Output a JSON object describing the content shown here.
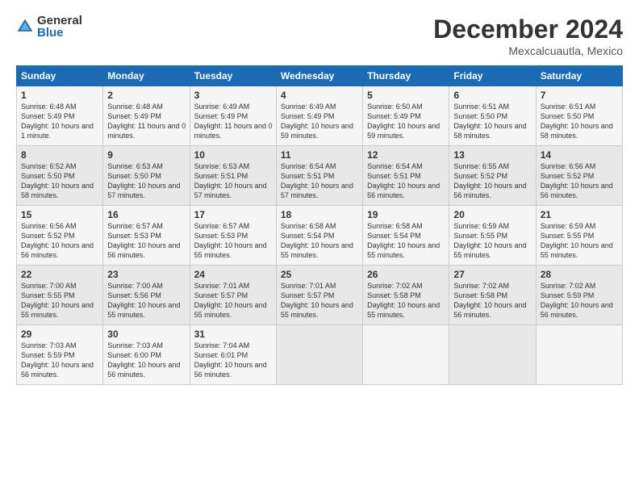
{
  "header": {
    "logo_general": "General",
    "logo_blue": "Blue",
    "title": "December 2024",
    "location": "Mexcalcuautla, Mexico"
  },
  "days_of_week": [
    "Sunday",
    "Monday",
    "Tuesday",
    "Wednesday",
    "Thursday",
    "Friday",
    "Saturday"
  ],
  "weeks": [
    [
      {
        "day": 1,
        "sunrise": "6:48 AM",
        "sunset": "5:49 PM",
        "daylight": "10 hours and 1 minute."
      },
      {
        "day": 2,
        "sunrise": "6:48 AM",
        "sunset": "5:49 PM",
        "daylight": "11 hours and 0 minutes."
      },
      {
        "day": 3,
        "sunrise": "6:49 AM",
        "sunset": "5:49 PM",
        "daylight": "11 hours and 0 minutes."
      },
      {
        "day": 4,
        "sunrise": "6:49 AM",
        "sunset": "5:49 PM",
        "daylight": "10 hours and 59 minutes."
      },
      {
        "day": 5,
        "sunrise": "6:50 AM",
        "sunset": "5:49 PM",
        "daylight": "10 hours and 59 minutes."
      },
      {
        "day": 6,
        "sunrise": "6:51 AM",
        "sunset": "5:50 PM",
        "daylight": "10 hours and 58 minutes."
      },
      {
        "day": 7,
        "sunrise": "6:51 AM",
        "sunset": "5:50 PM",
        "daylight": "10 hours and 58 minutes."
      }
    ],
    [
      {
        "day": 8,
        "sunrise": "6:52 AM",
        "sunset": "5:50 PM",
        "daylight": "10 hours and 58 minutes."
      },
      {
        "day": 9,
        "sunrise": "6:53 AM",
        "sunset": "5:50 PM",
        "daylight": "10 hours and 57 minutes."
      },
      {
        "day": 10,
        "sunrise": "6:53 AM",
        "sunset": "5:51 PM",
        "daylight": "10 hours and 57 minutes."
      },
      {
        "day": 11,
        "sunrise": "6:54 AM",
        "sunset": "5:51 PM",
        "daylight": "10 hours and 57 minutes."
      },
      {
        "day": 12,
        "sunrise": "6:54 AM",
        "sunset": "5:51 PM",
        "daylight": "10 hours and 56 minutes."
      },
      {
        "day": 13,
        "sunrise": "6:55 AM",
        "sunset": "5:52 PM",
        "daylight": "10 hours and 56 minutes."
      },
      {
        "day": 14,
        "sunrise": "6:56 AM",
        "sunset": "5:52 PM",
        "daylight": "10 hours and 56 minutes."
      }
    ],
    [
      {
        "day": 15,
        "sunrise": "6:56 AM",
        "sunset": "5:52 PM",
        "daylight": "10 hours and 56 minutes."
      },
      {
        "day": 16,
        "sunrise": "6:57 AM",
        "sunset": "5:53 PM",
        "daylight": "10 hours and 56 minutes."
      },
      {
        "day": 17,
        "sunrise": "6:57 AM",
        "sunset": "5:53 PM",
        "daylight": "10 hours and 55 minutes."
      },
      {
        "day": 18,
        "sunrise": "6:58 AM",
        "sunset": "5:54 PM",
        "daylight": "10 hours and 55 minutes."
      },
      {
        "day": 19,
        "sunrise": "6:58 AM",
        "sunset": "5:54 PM",
        "daylight": "10 hours and 55 minutes."
      },
      {
        "day": 20,
        "sunrise": "6:59 AM",
        "sunset": "5:55 PM",
        "daylight": "10 hours and 55 minutes."
      },
      {
        "day": 21,
        "sunrise": "6:59 AM",
        "sunset": "5:55 PM",
        "daylight": "10 hours and 55 minutes."
      }
    ],
    [
      {
        "day": 22,
        "sunrise": "7:00 AM",
        "sunset": "5:55 PM",
        "daylight": "10 hours and 55 minutes."
      },
      {
        "day": 23,
        "sunrise": "7:00 AM",
        "sunset": "5:56 PM",
        "daylight": "10 hours and 55 minutes."
      },
      {
        "day": 24,
        "sunrise": "7:01 AM",
        "sunset": "5:57 PM",
        "daylight": "10 hours and 55 minutes."
      },
      {
        "day": 25,
        "sunrise": "7:01 AM",
        "sunset": "5:57 PM",
        "daylight": "10 hours and 55 minutes."
      },
      {
        "day": 26,
        "sunrise": "7:02 AM",
        "sunset": "5:58 PM",
        "daylight": "10 hours and 55 minutes."
      },
      {
        "day": 27,
        "sunrise": "7:02 AM",
        "sunset": "5:58 PM",
        "daylight": "10 hours and 56 minutes."
      },
      {
        "day": 28,
        "sunrise": "7:02 AM",
        "sunset": "5:59 PM",
        "daylight": "10 hours and 56 minutes."
      }
    ],
    [
      {
        "day": 29,
        "sunrise": "7:03 AM",
        "sunset": "5:59 PM",
        "daylight": "10 hours and 56 minutes."
      },
      {
        "day": 30,
        "sunrise": "7:03 AM",
        "sunset": "6:00 PM",
        "daylight": "10 hours and 56 minutes."
      },
      {
        "day": 31,
        "sunrise": "7:04 AM",
        "sunset": "6:01 PM",
        "daylight": "10 hours and 56 minutes."
      },
      null,
      null,
      null,
      null
    ]
  ],
  "row_labels": {
    "sunrise": "Sunrise:",
    "sunset": "Sunset:",
    "daylight": "Daylight:"
  }
}
